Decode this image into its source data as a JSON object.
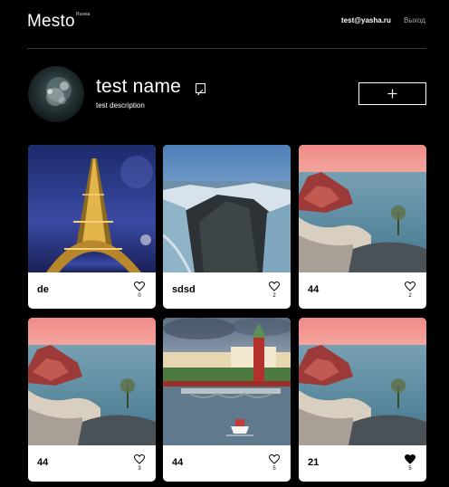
{
  "header": {
    "logo": "Mesto",
    "logo_sup": "Russia",
    "email": "test@yasha.ru",
    "logout": "Выход"
  },
  "profile": {
    "name": "test name",
    "description": "test description"
  },
  "cards": [
    {
      "title": "de",
      "likes": "0",
      "liked": false,
      "image": "eiffel-tower"
    },
    {
      "title": "sdsd",
      "likes": "2",
      "liked": false,
      "image": "mountain-cliff"
    },
    {
      "title": "44",
      "likes": "2",
      "liked": false,
      "image": "baikal-rock"
    },
    {
      "title": "44",
      "likes": "3",
      "liked": false,
      "image": "baikal-rock"
    },
    {
      "title": "44",
      "likes": "5",
      "liked": false,
      "image": "moscow-kremlin"
    },
    {
      "title": "21",
      "likes": "5",
      "liked": true,
      "image": "baikal-rock"
    }
  ],
  "colors": {
    "background": "#000000",
    "card": "#ffffff",
    "divider": "#545454"
  }
}
